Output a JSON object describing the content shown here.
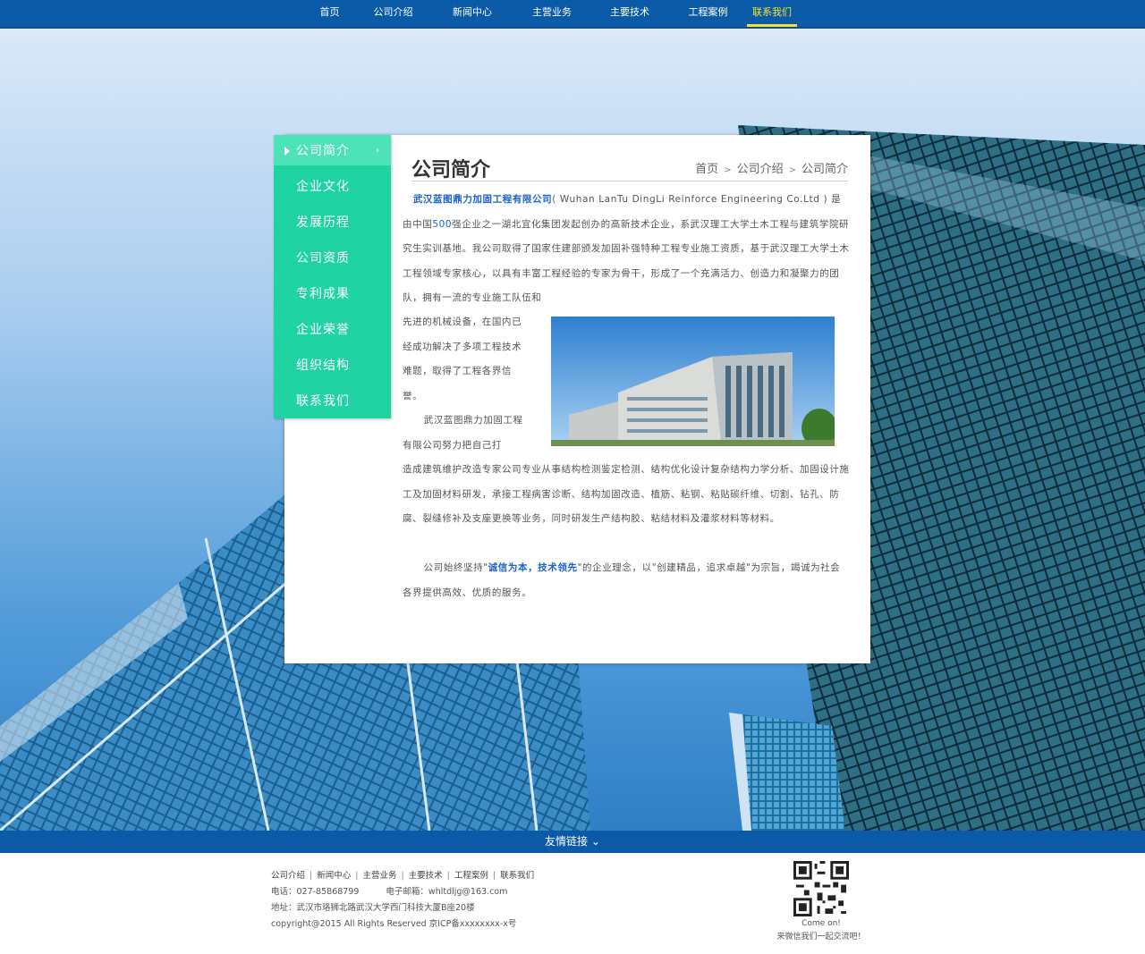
{
  "nav": {
    "items": [
      "首页",
      "公司介绍",
      "新闻中心",
      "主营业务",
      "主要技术",
      "工程案例",
      "联系我们"
    ],
    "active_index": 6,
    "bg_color": "#0a5aa8",
    "active_color": "#f4e23a"
  },
  "sidenav": {
    "items": [
      "公司简介",
      "企业文化",
      "发展历程",
      "公司资质",
      "专利成果",
      "企业荣誉",
      "组织结构",
      "联系我们"
    ],
    "active_index": 0,
    "bg_color": "#1fd4a2"
  },
  "panel": {
    "title": "公司简介",
    "breadcrumb": [
      "首页",
      "公司介绍",
      "公司简介"
    ],
    "p1_company": "武汉蓝图鼎力加固工程有限公司",
    "p1_a": "( Wuhan  LanTu DingLi Reinforce Engineering Co.Ltd ) 是由中国",
    "p1_500": "500",
    "p1_b": "强企业之一湖北宜化集团发起创办的高新技术企业，系武汉理工大学土木工程与建筑学院研究生实训基地。我公司取得了国家住建部颁发加固补强特种工程专业施工资质，基于武汉理工大学土木工程领域专家核心，以具有丰富工程经验的专家为骨干，形成了一个充满活力、创造力和凝聚力的团队，拥有一流的专业施工队伍和",
    "p2": "先进的机械设备，在国内已经成功解决了多项工程技术难题，取得了工程各界信誉。",
    "p2b": "武汉蓝图鼎力加固工程有限公司努力把自己打",
    "p3": "造成建筑维护改造专家公司专业从事结构检测鉴定检测、结构优化设计复杂结构力学分析、加固设计施工及加固材料研发，承接工程病害诊断、结构加固改造、植筋、粘钢、粘贴碳纤维、切割、钻孔、防腐、裂缝修补及支座更换等业务，同时研发生产结构胶、粘结材料及灌浆材料等材料。",
    "p4_a": "公司始终坚持\"",
    "p4_hl": "诚信为本，技术领先",
    "p4_b": "\"的企业理念，以\"创建精品，追求卓越\"为宗旨，竭诚为社会各界提供高效、优质的服务。"
  },
  "linkbar": {
    "label": "友情链接",
    "icon": "chevron-down-icon"
  },
  "footer": {
    "links": [
      "公司介绍",
      "新闻中心",
      "主营业务",
      "主要技术",
      "工程案例",
      "联系我们"
    ],
    "phone": "电话：027-85868799",
    "email": "电子邮箱：whltdljg@163.com",
    "address": "地址：武汉市珞狮北路武汉大学西门科技大厦B座20楼",
    "copyright": "copyright@2015    All Rights Reserved  京ICP备xxxxxxxx-x号",
    "qr_caption_1": "Come on!",
    "qr_caption_2": "来微信我们一起交流吧！"
  }
}
